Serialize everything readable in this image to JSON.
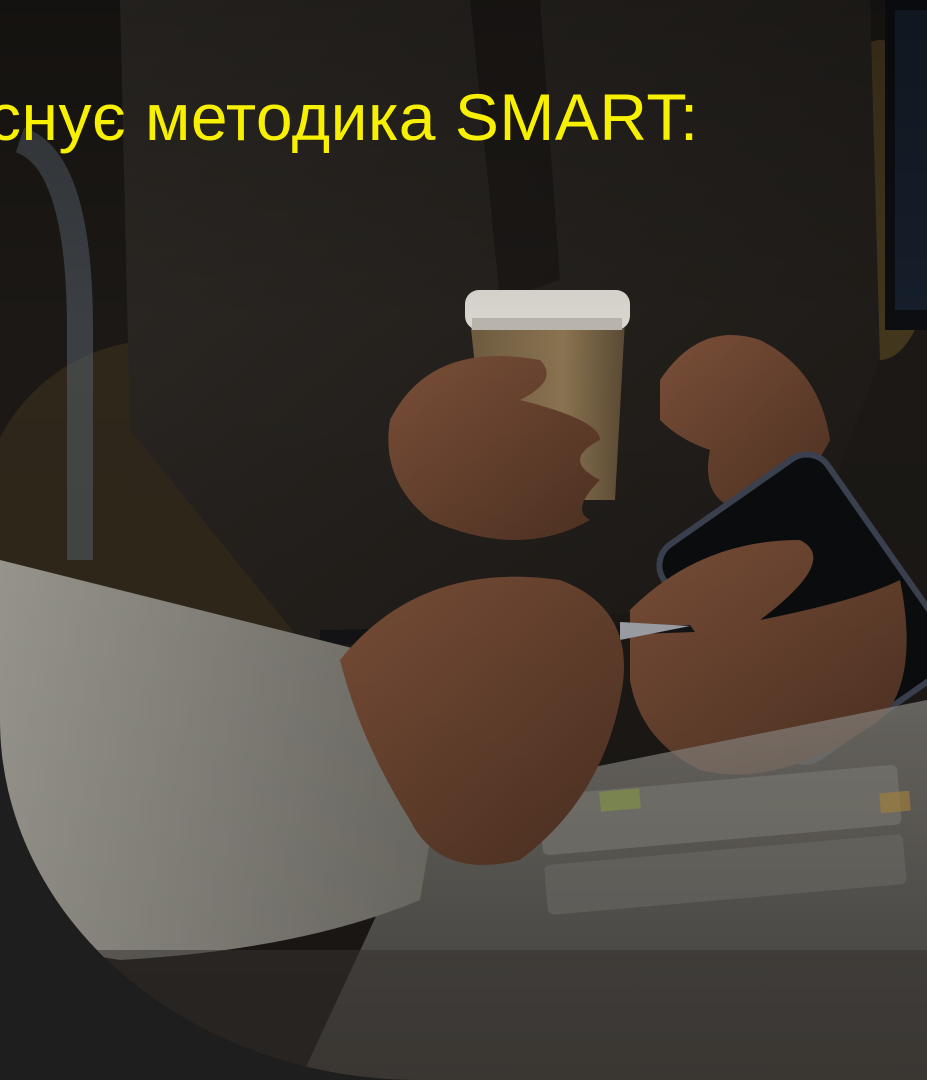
{
  "slide": {
    "heading": "снує методика SMART:"
  },
  "photo": {
    "subject": "photo-office-phone-coffee",
    "accent_color": "#f7f000",
    "background_color": "#1e1e1e"
  }
}
